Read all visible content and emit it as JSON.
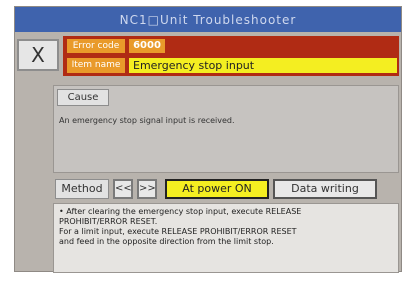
{
  "title": "NC1□Unit  Troubleshooter",
  "close_label": "X",
  "error_code": {
    "label": "Error code",
    "value": "6000"
  },
  "item_name": {
    "label": "Item name",
    "value": "Emergency stop input"
  },
  "cause": {
    "tab_label": "Cause",
    "text": "An emergency stop signal input is received."
  },
  "method": {
    "label": "Method",
    "prev_label": "<<",
    "next_label": ">>",
    "power_on_label": "At power ON",
    "data_writing_label": "Data writing",
    "lines": [
      "• After clearing the emergency stop input, execute RELEASE",
      "PROHIBIT/ERROR RESET.",
      "For a limit input, execute RELEASE PROHIBIT/ERROR RESET",
      "and feed in the opposite direction from the limit stop."
    ]
  },
  "colors": {
    "title_bar": "#3f63ad",
    "header_panel": "#b02b14",
    "label_orange": "#e99a2a",
    "highlight_yellow": "#f4ee21"
  }
}
